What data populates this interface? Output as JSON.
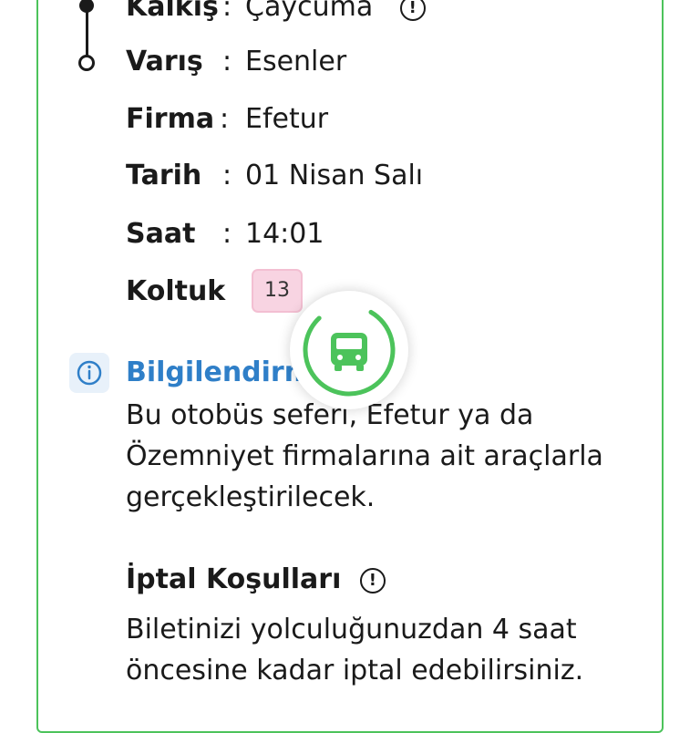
{
  "trip": {
    "departure": {
      "label": "Kalkış",
      "colon": ":",
      "value": "Çaycuma"
    },
    "arrival": {
      "label": "Varış",
      "colon": ":",
      "value": "Esenler"
    },
    "company": {
      "label": "Firma",
      "colon": ":",
      "value": "Efetur"
    },
    "date": {
      "label": "Tarih",
      "colon": ":",
      "value": "01 Nisan Salı"
    },
    "time": {
      "label": "Saat",
      "colon": ":",
      "value": "14:01"
    },
    "seat": {
      "label": "Koltuk",
      "colon": ":",
      "value": "13"
    }
  },
  "info": {
    "title": "Bilgilendirm",
    "lines": [
      "Bu otobüs seferi, Efetur ya da",
      "Özemniyet firmalarına ait araçlarla",
      "gerçekleştirilecek."
    ]
  },
  "cancellation": {
    "title": "İptal Koşulları",
    "lines": [
      "Biletinizi yolculuğunuzdan 4 saat",
      "öncesine kadar iptal edebilirsiniz."
    ]
  },
  "icons": {
    "info_mark": "!",
    "loading": "bus-icon"
  },
  "colors": {
    "card_border": "#4cc35b",
    "accent_blue": "#2f7fc8",
    "seat_badge": "#f8d4e2",
    "spinner": "#4cc35b"
  }
}
